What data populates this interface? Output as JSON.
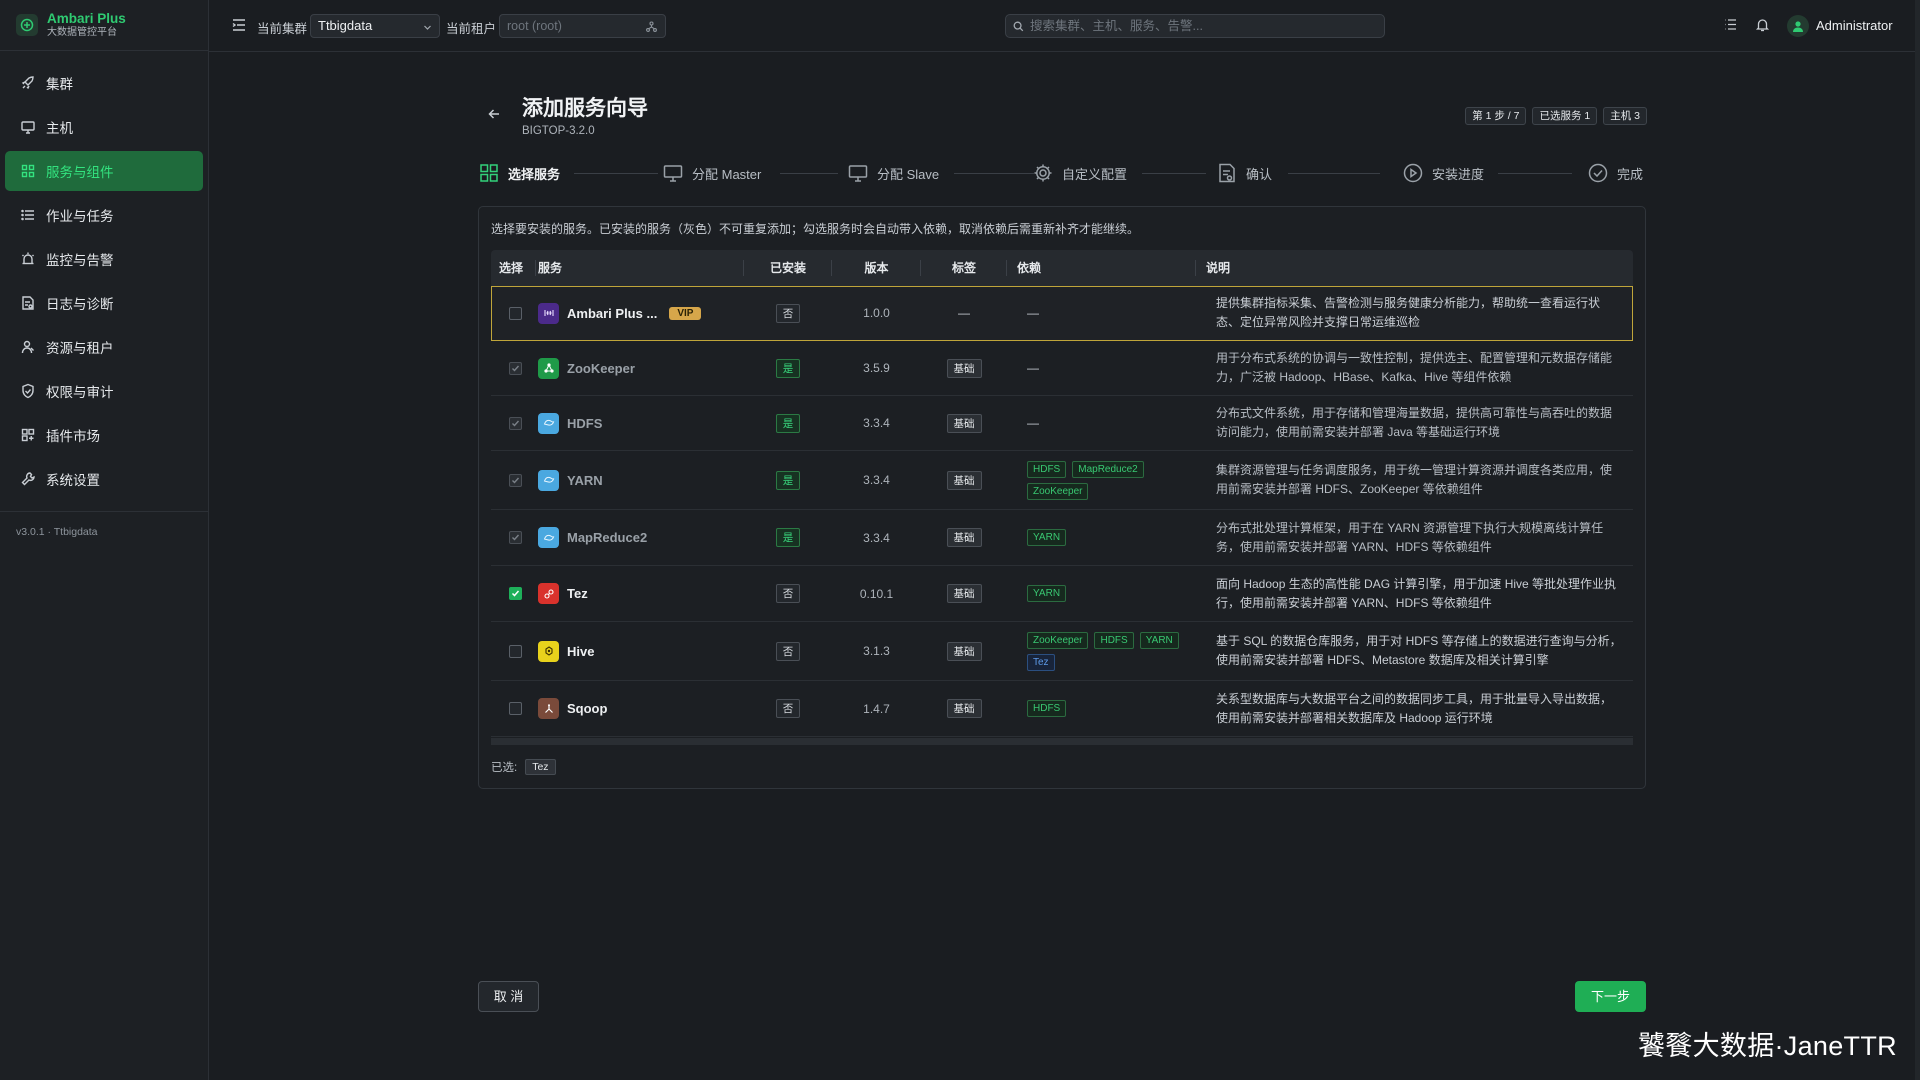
{
  "brand": {
    "name": "Ambari Plus",
    "subtitle": "大数据管控平台"
  },
  "sidebar": {
    "items": [
      {
        "label": "集群",
        "icon": "rocket-icon",
        "active": false
      },
      {
        "label": "主机",
        "icon": "monitor-icon",
        "active": false
      },
      {
        "label": "服务与组件",
        "icon": "grid-icon",
        "active": true
      },
      {
        "label": "作业与任务",
        "icon": "list-icon",
        "active": false
      },
      {
        "label": "监控与告警",
        "icon": "alarm-icon",
        "active": false
      },
      {
        "label": "日志与诊断",
        "icon": "log-icon",
        "active": false
      },
      {
        "label": "资源与租户",
        "icon": "tenant-icon",
        "active": false
      },
      {
        "label": "权限与审计",
        "icon": "shield-icon",
        "active": false
      },
      {
        "label": "插件市场",
        "icon": "plugin-icon",
        "active": false
      },
      {
        "label": "系统设置",
        "icon": "wrench-icon",
        "active": false
      }
    ],
    "version": "v3.0.1 · Ttbigdata"
  },
  "topbar": {
    "cluster_label": "当前集群",
    "cluster_value": "Ttbigdata",
    "tenant_label": "当前租户",
    "tenant_placeholder": "root (root)",
    "search_placeholder": "搜索集群、主机、服务、告警...",
    "user": "Administrator"
  },
  "page": {
    "title": "添加服务向导",
    "subtitle": "BIGTOP-3.2.0",
    "chips": [
      "第 1 步 / 7",
      "已选服务 1",
      "主机 3"
    ]
  },
  "steps": [
    {
      "label": "选择服务",
      "icon": "grid-icon",
      "active": true
    },
    {
      "label": "分配 Master",
      "icon": "monitor-icon",
      "active": false
    },
    {
      "label": "分配 Slave",
      "icon": "monitor-icon",
      "active": false
    },
    {
      "label": "自定义配置",
      "icon": "gear-icon",
      "active": false
    },
    {
      "label": "确认",
      "icon": "document-icon",
      "active": false
    },
    {
      "label": "安装进度",
      "icon": "play-icon",
      "active": false
    },
    {
      "label": "完成",
      "icon": "check-circle-icon",
      "active": false
    }
  ],
  "hint": "选择要安装的服务。已安装的服务（灰色）不可重复添加；勾选服务时会自动带入依赖，取消依赖后需重新补齐才能继续。",
  "table": {
    "headers": [
      "选择",
      "服务",
      "已安装",
      "版本",
      "标签",
      "依赖",
      "说明"
    ],
    "rows": [
      {
        "name": "Ambari Plus ...",
        "vip": "VIP",
        "icon_bg": "#4b2a8a",
        "icon": "ambari-icon",
        "installed": "否",
        "version": "1.0.0",
        "tag": "—",
        "deps": [
          "—"
        ],
        "desc": "提供集群指标采集、告警检测与服务健康分析能力，帮助统一查看运行状态、定位异常风险并支撑日常运维巡检",
        "state": "unchecked"
      },
      {
        "name": "ZooKeeper",
        "icon_bg": "#1f9a48",
        "icon": "zookeeper-icon",
        "installed": "是",
        "version": "3.5.9",
        "tag": "基础",
        "deps": [
          "—"
        ],
        "desc": "用于分布式系统的协调与一致性控制，提供选主、配置管理和元数据存储能力，广泛被 Hadoop、HBase、Kafka、Hive 等组件依赖",
        "state": "disabled"
      },
      {
        "name": "HDFS",
        "icon_bg": "#4aa8e0",
        "icon": "hdfs-icon",
        "installed": "是",
        "version": "3.3.4",
        "tag": "基础",
        "deps": [
          "—"
        ],
        "desc": "分布式文件系统，用于存储和管理海量数据，提供高可靠性与高吞吐的数据访问能力，使用前需安装并部署 Java 等基础运行环境",
        "state": "disabled"
      },
      {
        "name": "YARN",
        "icon_bg": "#4aa8e0",
        "icon": "yarn-icon",
        "installed": "是",
        "version": "3.3.4",
        "tag": "基础",
        "deps": [
          "HDFS",
          "MapReduce2",
          "ZooKeeper"
        ],
        "desc": "集群资源管理与任务调度服务，用于统一管理计算资源并调度各类应用，使用前需安装并部署 HDFS、ZooKeeper 等依赖组件",
        "state": "disabled"
      },
      {
        "name": "MapReduce2",
        "icon_bg": "#4aa8e0",
        "icon": "mapreduce-icon",
        "installed": "是",
        "version": "3.3.4",
        "tag": "基础",
        "deps": [
          "YARN"
        ],
        "desc": "分布式批处理计算框架，用于在 YARN 资源管理下执行大规模离线计算任务，使用前需安装并部署 YARN、HDFS 等依赖组件",
        "state": "disabled"
      },
      {
        "name": "Tez",
        "icon_bg": "#d9322c",
        "icon": "tez-icon",
        "installed": "否",
        "version": "0.10.1",
        "tag": "基础",
        "deps": [
          "YARN"
        ],
        "desc": "面向 Hadoop 生态的高性能 DAG 计算引擎，用于加速 Hive 等批处理作业执行，使用前需安装并部署 YARN、HDFS 等依赖组件",
        "state": "checked"
      },
      {
        "name": "Hive",
        "icon_bg": "#e8d21c",
        "icon": "hive-icon",
        "installed": "否",
        "version": "3.1.3",
        "tag": "基础",
        "deps": [
          "ZooKeeper",
          "HDFS",
          "YARN",
          "Tez"
        ],
        "desc": "基于 SQL 的数据仓库服务，用于对 HDFS 等存储上的数据进行查询与分析，使用前需安装并部署 HDFS、Metastore 数据库及相关计算引擎",
        "state": "unchecked"
      },
      {
        "name": "Sqoop",
        "icon_bg": "#7a4a3a",
        "icon": "sqoop-icon",
        "installed": "否",
        "version": "1.4.7",
        "tag": "基础",
        "deps": [
          "HDFS"
        ],
        "desc": "关系型数据库与大数据平台之间的数据同步工具，用于批量导入导出数据，使用前需安装并部署相关数据库及 Hadoop 运行环境",
        "state": "unchecked"
      }
    ]
  },
  "selected": {
    "label": "已选:",
    "items": [
      "Tez"
    ]
  },
  "buttons": {
    "cancel": "取 消",
    "next": "下一步"
  },
  "watermark": "饕餮大数据·JaneTTR",
  "colors": {
    "accent": "#1fae55",
    "active_nav_bg": "#1f6b3c",
    "vip": "#d6a64a",
    "highlight_border": "#bfa53a"
  }
}
